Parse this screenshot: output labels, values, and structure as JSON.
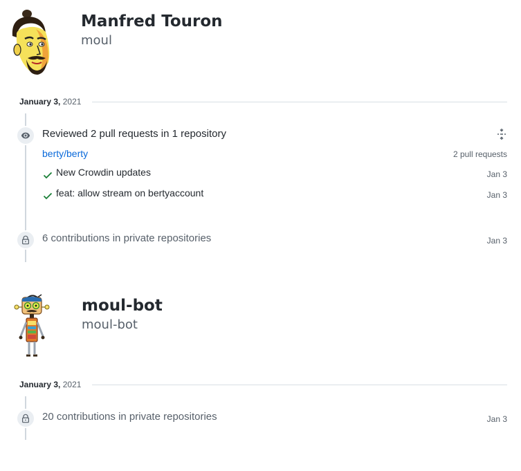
{
  "users": [
    {
      "name": "Manfred Touron",
      "login": "moul",
      "date": {
        "month_day": "January 3,",
        "year": "2021"
      },
      "review_event": {
        "title": "Reviewed 2 pull requests in 1 repository",
        "repo": "berty/berty",
        "count_label": "2 pull requests",
        "items": [
          {
            "title": "New Crowdin updates",
            "date": "Jan 3"
          },
          {
            "title": "feat: allow stream on bertyaccount",
            "date": "Jan 3"
          }
        ]
      },
      "private_event": {
        "title": "6 contributions in private repositories",
        "date": "Jan 3"
      }
    },
    {
      "name": "moul-bot",
      "login": "moul-bot",
      "date": {
        "month_day": "January 3,",
        "year": "2021"
      },
      "private_event": {
        "title": "20 contributions in private repositories",
        "date": "Jan 3"
      }
    }
  ],
  "icons": {
    "review": "eye-icon",
    "private": "lock-icon",
    "merged": "check-icon",
    "collapse": "fold-icon"
  },
  "colors": {
    "link": "#0969da",
    "check": "#1a7f37",
    "muted": "#57606a",
    "timeline": "#d0d7de"
  }
}
